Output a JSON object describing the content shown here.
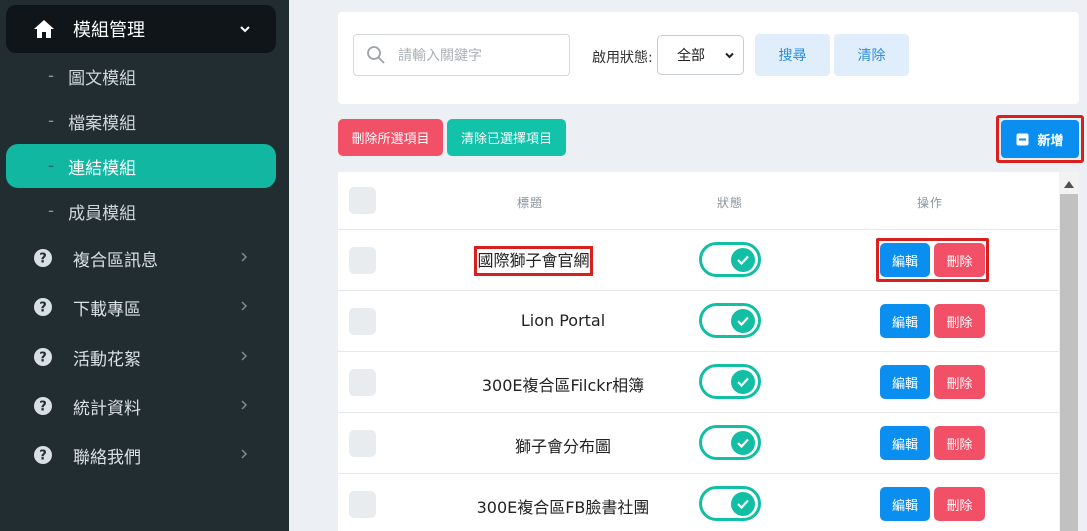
{
  "sidebar": {
    "main_menu": "模組管理",
    "subitems": [
      "圖文模組",
      "檔案模組",
      "連結模組",
      "成員模組"
    ],
    "active_subitem": "連結模組",
    "groups": [
      "複合區訊息",
      "下載專區",
      "活動花絮",
      "統計資料",
      "聯絡我們"
    ]
  },
  "search": {
    "placeholder": "請輸入關鍵字",
    "status_label": "啟用狀態:",
    "status_selected": "全部",
    "search_button": "搜尋",
    "clear_button": "清除"
  },
  "actions": {
    "delete_selected": "刪除所選項目",
    "clear_selected": "清除已選擇項目",
    "add": "新增"
  },
  "table": {
    "headers": {
      "title": "標題",
      "status": "狀態",
      "actions": "操作"
    },
    "edit_label": "編輯",
    "delete_label": "刪除",
    "rows": [
      {
        "title": "國際獅子會官網",
        "enabled": true
      },
      {
        "title": "Lion Portal",
        "enabled": true
      },
      {
        "title": "300E複合區Filckr相簿",
        "enabled": true
      },
      {
        "title": "獅子會分布圖",
        "enabled": true
      },
      {
        "title": "300E複合區FB臉書社團",
        "enabled": true
      }
    ]
  },
  "colors": {
    "sidebar_bg": "#222d32",
    "active_item": "#12b7a1",
    "primary": "#0a8ff0",
    "danger": "#f25066",
    "teal": "#12c2a9",
    "highlight_box": "#d9201f"
  }
}
